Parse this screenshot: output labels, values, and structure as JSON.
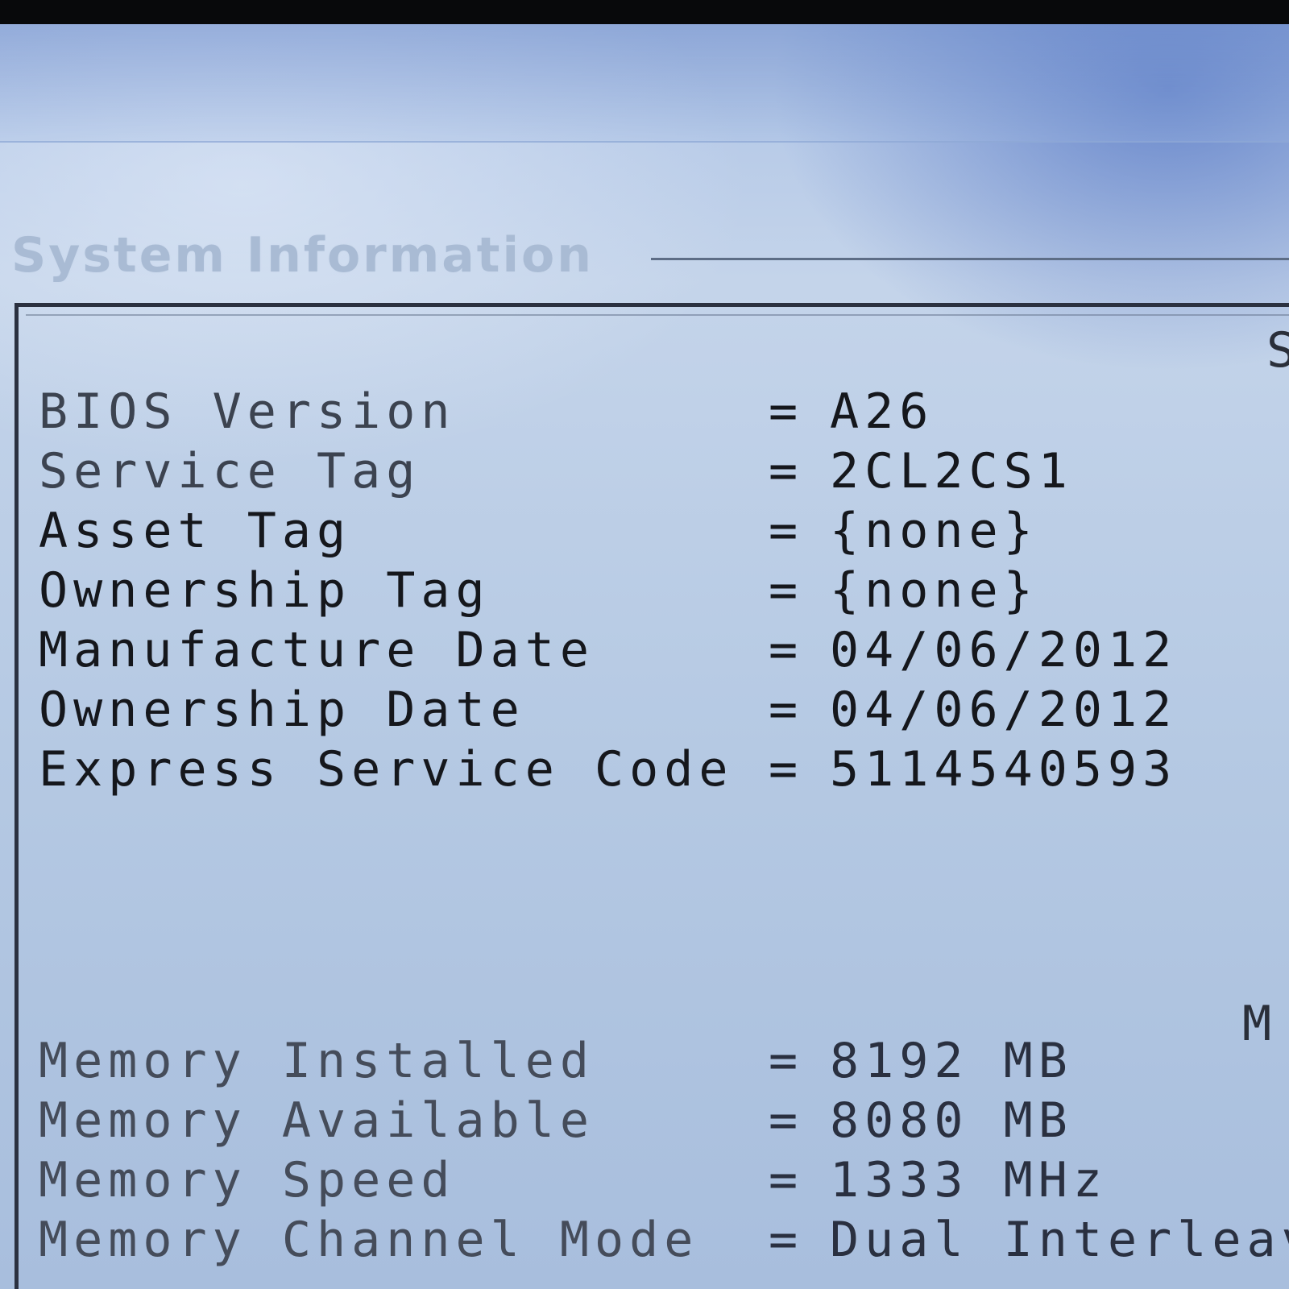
{
  "section_title": "System Information",
  "edge_chars": {
    "top_right": "S",
    "bottom_right": "M"
  },
  "system_rows": [
    {
      "label": "BIOS Version",
      "separator": "=",
      "value": "A26"
    },
    {
      "label": "Service Tag",
      "separator": "=",
      "value": "2CL2CS1"
    },
    {
      "label": "Asset Tag",
      "separator": "=",
      "value": "{none}"
    },
    {
      "label": "Ownership Tag",
      "separator": "=",
      "value": "{none}"
    },
    {
      "label": "Manufacture Date",
      "separator": "=",
      "value": "04/06/2012"
    },
    {
      "label": "Ownership Date",
      "separator": "=",
      "value": "04/06/2012"
    },
    {
      "label": "Express Service Code",
      "separator": "=",
      "value": "5114540593"
    }
  ],
  "memory_rows": [
    {
      "label": "Memory Installed",
      "separator": "=",
      "value": "8192 MB"
    },
    {
      "label": "Memory Available",
      "separator": "=",
      "value": "8080 MB"
    },
    {
      "label": "Memory Speed",
      "separator": "=",
      "value": "1333 MHz"
    },
    {
      "label": "Memory Channel Mode",
      "separator": "=",
      "value": "Dual Interleave"
    }
  ]
}
